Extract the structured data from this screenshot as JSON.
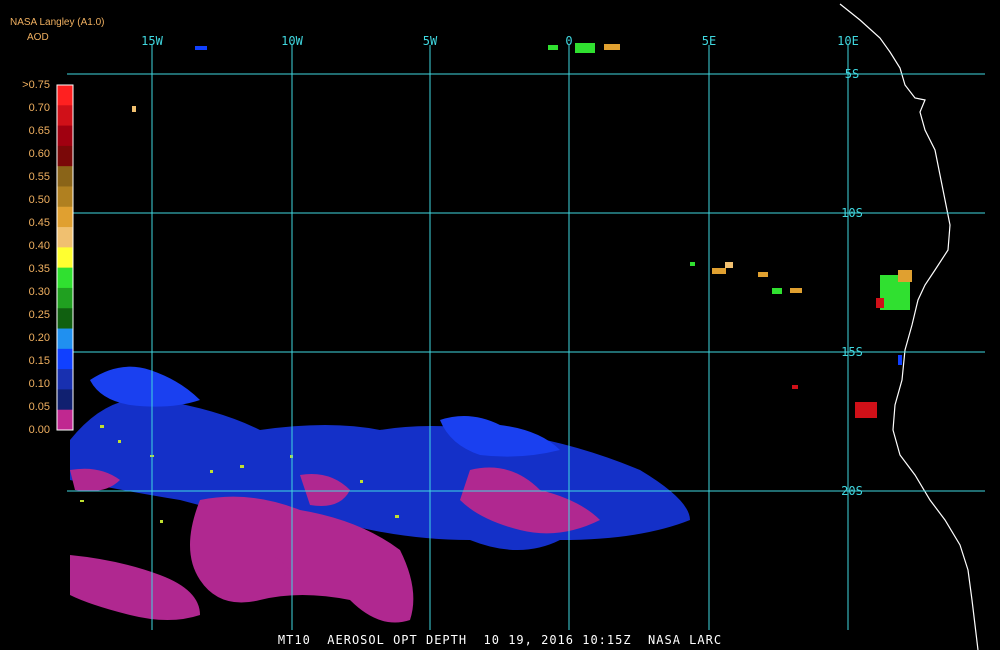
{
  "header": {
    "source": "NASA Langley (A1.0)",
    "product": "AOD"
  },
  "footer": {
    "caption": "MT10  AEROSOL OPT DEPTH  10 19, 2016 10:15Z  NASA LARC"
  },
  "legend": {
    "labels": [
      ">0.75",
      "0.70",
      "0.65",
      "0.60",
      "0.55",
      "0.50",
      "0.45",
      "0.40",
      "0.35",
      "0.30",
      "0.25",
      "0.20",
      "0.15",
      "0.10",
      "0.05",
      "0.00"
    ],
    "colors": [
      "#ff2020",
      "#d01018",
      "#a00010",
      "#7a0808",
      "#8a6418",
      "#b08020",
      "#e0a030",
      "#f0c070",
      "#ffff30",
      "#30e030",
      "#20a020",
      "#106010",
      "#2090f0",
      "#1040ff",
      "#1830b0",
      "#102070",
      "#c02890"
    ]
  },
  "grid": {
    "lon_labels": [
      "15W",
      "10W",
      "5W",
      "0",
      "5E",
      "10E"
    ],
    "lat_labels": [
      "5S",
      "10S",
      "15S",
      "20S"
    ]
  },
  "colors": {
    "grid": "#40d8e0",
    "coast": "#ffffff",
    "label_orange": "#f0b060"
  }
}
